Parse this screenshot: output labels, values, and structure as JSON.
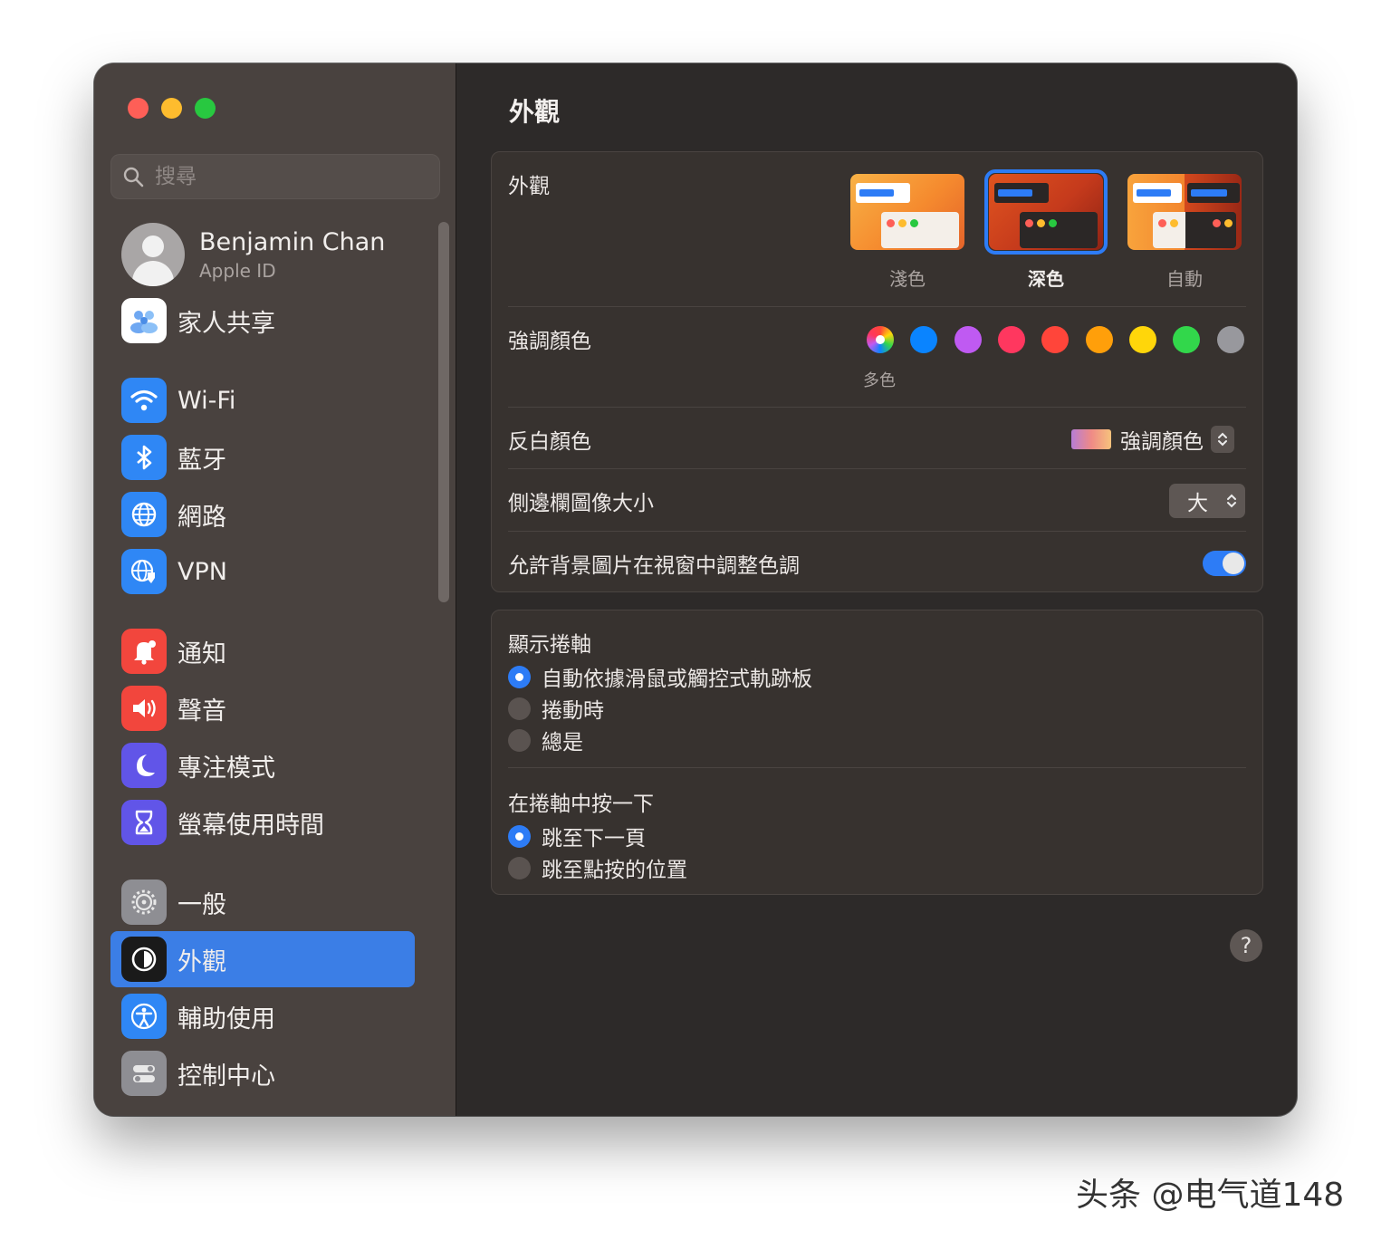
{
  "window": {
    "title": "外觀"
  },
  "search": {
    "placeholder": "搜尋"
  },
  "profile": {
    "name": "Benjamin Chan",
    "subtitle": "Apple ID"
  },
  "sidebar": {
    "items": [
      {
        "label": "家人共享",
        "icon": "family-icon"
      },
      {
        "label": "Wi-Fi",
        "icon": "wifi-icon"
      },
      {
        "label": "藍牙",
        "icon": "bluetooth-icon"
      },
      {
        "label": "網路",
        "icon": "network-icon"
      },
      {
        "label": "VPN",
        "icon": "vpn-icon"
      },
      {
        "label": "通知",
        "icon": "bell-icon"
      },
      {
        "label": "聲音",
        "icon": "speaker-icon"
      },
      {
        "label": "專注模式",
        "icon": "moon-icon"
      },
      {
        "label": "螢幕使用時間",
        "icon": "hourglass-icon"
      },
      {
        "label": "一般",
        "icon": "gear-icon"
      },
      {
        "label": "外觀",
        "icon": "appearance-icon",
        "active": true
      },
      {
        "label": "輔助使用",
        "icon": "accessibility-icon"
      },
      {
        "label": "控制中心",
        "icon": "control-center-icon"
      }
    ]
  },
  "appearance": {
    "label": "外觀",
    "options": [
      {
        "label": "淺色",
        "selected": false
      },
      {
        "label": "深色",
        "selected": true
      },
      {
        "label": "自動",
        "selected": false
      }
    ]
  },
  "accent": {
    "label": "強調顏色",
    "multicolor_label": "多色",
    "colors": [
      "multicolor",
      "#0a84ff",
      "#bf5af2",
      "#ff375f",
      "#ff453a",
      "#ff9f0a",
      "#ffd60a",
      "#32d74b",
      "#98989d"
    ]
  },
  "highlight": {
    "label": "反白顏色",
    "value": "強調顏色"
  },
  "sidebar_icon_size": {
    "label": "側邊欄圖像大小",
    "value": "大"
  },
  "wallpaper_tint": {
    "label": "允許背景圖片在視窗中調整色調",
    "enabled": true
  },
  "show_scrollbars": {
    "label": "顯示捲軸",
    "options": [
      {
        "label": "自動依據滑鼠或觸控式軌跡板",
        "selected": true
      },
      {
        "label": "捲動時",
        "selected": false
      },
      {
        "label": "總是",
        "selected": false
      }
    ]
  },
  "click_scrollbar": {
    "label": "在捲軸中按一下",
    "options": [
      {
        "label": "跳至下一頁",
        "selected": true
      },
      {
        "label": "跳至點按的位置",
        "selected": false
      }
    ]
  },
  "help": {
    "label": "?"
  },
  "watermark": "头条 @电气道148",
  "colors": {
    "accent": "#2d7cf6",
    "sidebar_bg": "#49423f",
    "content_bg": "#2d2a29"
  }
}
